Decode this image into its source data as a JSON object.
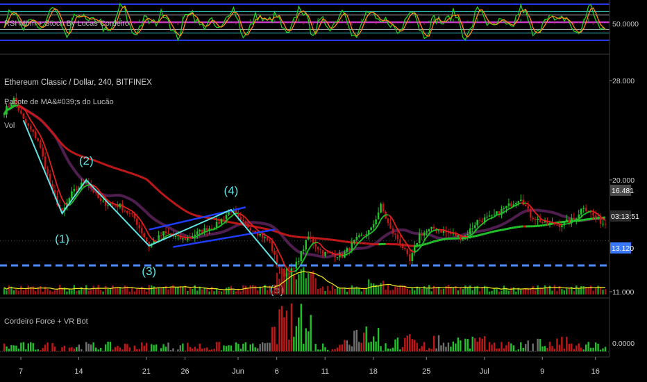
{
  "colors": {
    "background": "#000000",
    "up": "#22c02a",
    "down": "#c01818",
    "neutral": "#707070",
    "wave": "#5fe3e3",
    "channel": "#1f3dff",
    "support": "#4d8cff",
    "ma_fast": "#e02020",
    "ma_mid": "#7a2e7a",
    "ma_slow_up": "#22c02a",
    "ma_slow_down": "#c01818",
    "volume_ma": "#e8e020",
    "stoch_k": "#22d022",
    "stoch_d": "#ff8a1a",
    "band_outer": "#2a3dff",
    "band_mid": "#e040e0",
    "band_inner": "#38e0e0"
  },
  "header": {
    "symbol": "Ethereum Classic / Dollar, 240, BITFINEX",
    "ma_pack": "Pacote de MA&#039;s do Lucão",
    "vol": "Vol"
  },
  "oscillator": {
    "title": "RSI Mbm + Stoch By Lucas Cordeiro",
    "price_label": "50.0000"
  },
  "force": {
    "title": "Cordeiro Force + VR Bot",
    "price_label": "0.0000"
  },
  "price_scale": {
    "ticks": [
      {
        "value": 28,
        "label": "28.000"
      },
      {
        "value": 20,
        "label": "20.000"
      },
      {
        "value": 11,
        "label": "11.000"
      }
    ],
    "current_price": {
      "value": 16.481,
      "label": "16.481"
    },
    "countdown": "03:13:51",
    "support": {
      "value": 13.12,
      "label": "13.120"
    }
  },
  "time_axis": {
    "ticks": [
      {
        "index": 0,
        "label": "7"
      },
      {
        "index": 24,
        "label": "14"
      },
      {
        "index": 52,
        "label": "21"
      },
      {
        "index": 68,
        "label": "26"
      },
      {
        "index": 90,
        "label": "Jun"
      },
      {
        "index": 106,
        "label": "6"
      },
      {
        "index": 126,
        "label": "11"
      },
      {
        "index": 146,
        "label": "18"
      },
      {
        "index": 168,
        "label": "25"
      },
      {
        "index": 192,
        "label": "Jul"
      },
      {
        "index": 216,
        "label": "9"
      },
      {
        "index": 238,
        "label": "16"
      }
    ]
  },
  "waves": [
    {
      "label": "(1)",
      "index": 24,
      "price": 17.3
    },
    {
      "label": "(2)",
      "index": 34,
      "price": 20.0
    },
    {
      "label": "(3)",
      "index": 60,
      "price": 14.7
    },
    {
      "label": "(4)",
      "index": 94,
      "price": 17.6
    },
    {
      "label": "(5)",
      "index": 113,
      "price": 13.2
    }
  ],
  "chart_data": {
    "type": "candlestick",
    "title": "Ethereum Classic / Dollar, 240, BITFINEX",
    "bars": 250,
    "ylim": [
      11,
      28
    ],
    "price_anchors": [
      [
        0,
        25.5
      ],
      [
        4,
        26.5
      ],
      [
        8,
        24.8
      ],
      [
        14,
        23.2
      ],
      [
        20,
        19.0
      ],
      [
        24,
        17.3
      ],
      [
        28,
        18.9
      ],
      [
        34,
        20.0
      ],
      [
        40,
        18.2
      ],
      [
        48,
        17.9
      ],
      [
        54,
        16.9
      ],
      [
        60,
        14.7
      ],
      [
        66,
        15.7
      ],
      [
        74,
        15.2
      ],
      [
        82,
        15.9
      ],
      [
        88,
        16.4
      ],
      [
        94,
        17.6
      ],
      [
        98,
        16.6
      ],
      [
        104,
        15.9
      ],
      [
        110,
        15.0
      ],
      [
        113,
        13.2
      ],
      [
        116,
        12.4
      ],
      [
        120,
        12.8
      ],
      [
        126,
        15.4
      ],
      [
        132,
        14.1
      ],
      [
        140,
        13.9
      ],
      [
        146,
        15.2
      ],
      [
        152,
        16.0
      ],
      [
        156,
        17.9
      ],
      [
        160,
        16.0
      ],
      [
        164,
        15.0
      ],
      [
        168,
        13.4
      ],
      [
        172,
        15.6
      ],
      [
        178,
        16.1
      ],
      [
        184,
        15.7
      ],
      [
        190,
        15.3
      ],
      [
        196,
        16.7
      ],
      [
        202,
        17.0
      ],
      [
        208,
        17.8
      ],
      [
        214,
        18.6
      ],
      [
        218,
        17.1
      ],
      [
        224,
        16.5
      ],
      [
        230,
        16.4
      ],
      [
        236,
        16.8
      ],
      [
        240,
        17.9
      ],
      [
        244,
        17.1
      ],
      [
        248,
        16.5
      ],
      [
        249,
        16.48
      ]
    ],
    "support_level": 13.12,
    "wave_points": [
      [
        24,
        17.3
      ],
      [
        34,
        20.0
      ],
      [
        60,
        14.7
      ],
      [
        94,
        17.6
      ],
      [
        113,
        13.2
      ]
    ],
    "channel_upper": [
      [
        60,
        16.0
      ],
      [
        100,
        17.8
      ]
    ],
    "channel_lower": [
      [
        70,
        14.6
      ],
      [
        112,
        16.0
      ]
    ],
    "oscillator_levels": [
      0,
      20,
      30,
      50,
      70,
      80,
      100
    ]
  }
}
